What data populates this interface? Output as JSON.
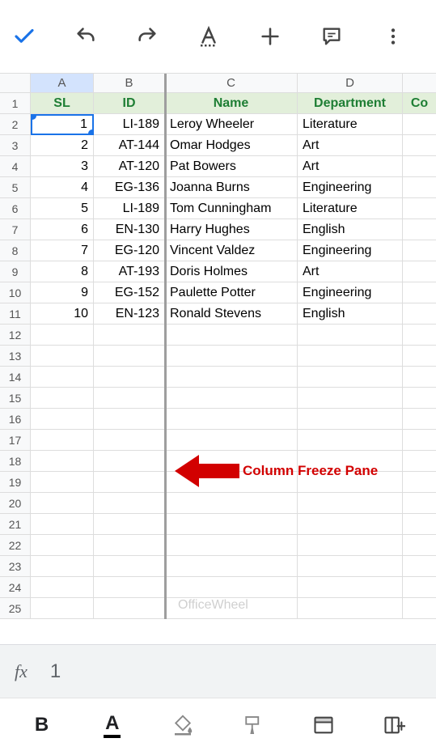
{
  "toolbar_top": {
    "confirm": "✓",
    "undo": "undo-icon",
    "redo": "redo-icon",
    "text_format": "text-format-icon",
    "insert": "+",
    "comment": "comment-icon",
    "more": "⋮"
  },
  "columns": [
    "A",
    "B",
    "C",
    "D"
  ],
  "partial_column_e": "Co",
  "headers": {
    "sl": "SL",
    "id": "ID",
    "name": "Name",
    "department": "Department"
  },
  "rows": [
    {
      "sl": "1",
      "id": "LI-189",
      "name": "Leroy Wheeler",
      "department": "Literature"
    },
    {
      "sl": "2",
      "id": "AT-144",
      "name": "Omar Hodges",
      "department": "Art"
    },
    {
      "sl": "3",
      "id": "AT-120",
      "name": "Pat Bowers",
      "department": "Art"
    },
    {
      "sl": "4",
      "id": "EG-136",
      "name": "Joanna Burns",
      "department": "Engineering"
    },
    {
      "sl": "5",
      "id": "LI-189",
      "name": "Tom Cunningham",
      "department": "Literature"
    },
    {
      "sl": "6",
      "id": "EN-130",
      "name": "Harry Hughes",
      "department": "English"
    },
    {
      "sl": "7",
      "id": "EG-120",
      "name": "Vincent Valdez",
      "department": "Engineering"
    },
    {
      "sl": "8",
      "id": "AT-193",
      "name": "Doris Holmes",
      "department": "Art"
    },
    {
      "sl": "9",
      "id": "EG-152",
      "name": "Paulette Potter",
      "department": "Engineering"
    },
    {
      "sl": "10",
      "id": "EN-123",
      "name": "Ronald Stevens",
      "department": "English"
    }
  ],
  "empty_row_count": 14,
  "annotation": {
    "text": "Column Freeze Pane"
  },
  "formula_bar": {
    "label": "fx",
    "value": "1"
  },
  "toolbar_bottom": {
    "bold": "B",
    "text_color": "A",
    "fill_color": "fill-icon",
    "cell_format": "cell-icon",
    "freeze": "freeze-icon",
    "insert": "insert-icon"
  },
  "watermark": "OfficeWheel"
}
